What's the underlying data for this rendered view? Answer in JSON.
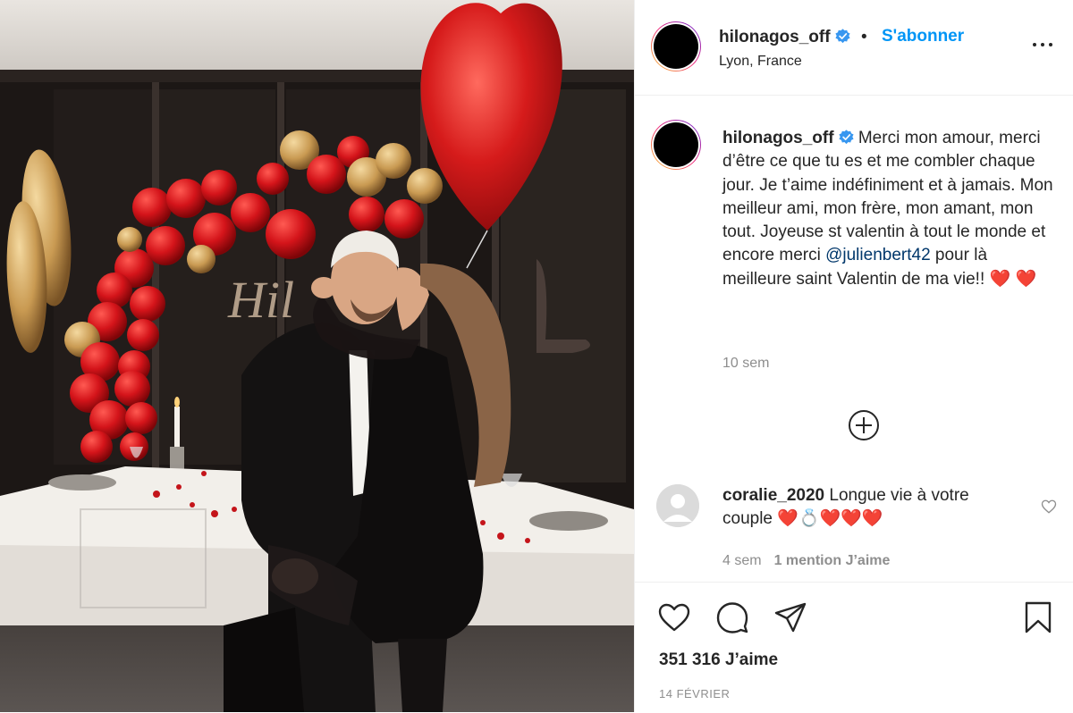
{
  "post": {
    "username": "hilonagos_off",
    "follow_label": "S'abonner",
    "separator": "•",
    "location": "Lyon, France",
    "verified_color": "#3897f0"
  },
  "caption": {
    "username": "hilonagos_off",
    "text_before_mention": "Merci mon amour, merci d’être ce que tu es et me combler chaque jour. Je t’aime indéfiniment et à jamais. Mon meilleur ami, mon frère, mon amant, mon tout. Joyeuse st valentin à tout le monde et encore merci ",
    "mention": "@julienbert42",
    "text_after_mention": " pour là meilleure saint Valentin de ma vie!! ",
    "hearts": "❤️ ❤️",
    "time": "10 sem"
  },
  "comment": {
    "username": "coralie_2020",
    "text": "Longue vie à votre couple ",
    "emojis": "❤️💍❤️❤️❤️",
    "time": "4 sem",
    "likes": "1 mention J’aime"
  },
  "footer": {
    "likes": "351 316 J’aime",
    "date": "14 FÉVRIER"
  },
  "icons": {
    "like": "heart-icon",
    "comment": "comment-icon",
    "share": "share-icon",
    "save": "bookmark-icon",
    "more": "more-options-icon",
    "load_more": "plus-circle-icon"
  }
}
